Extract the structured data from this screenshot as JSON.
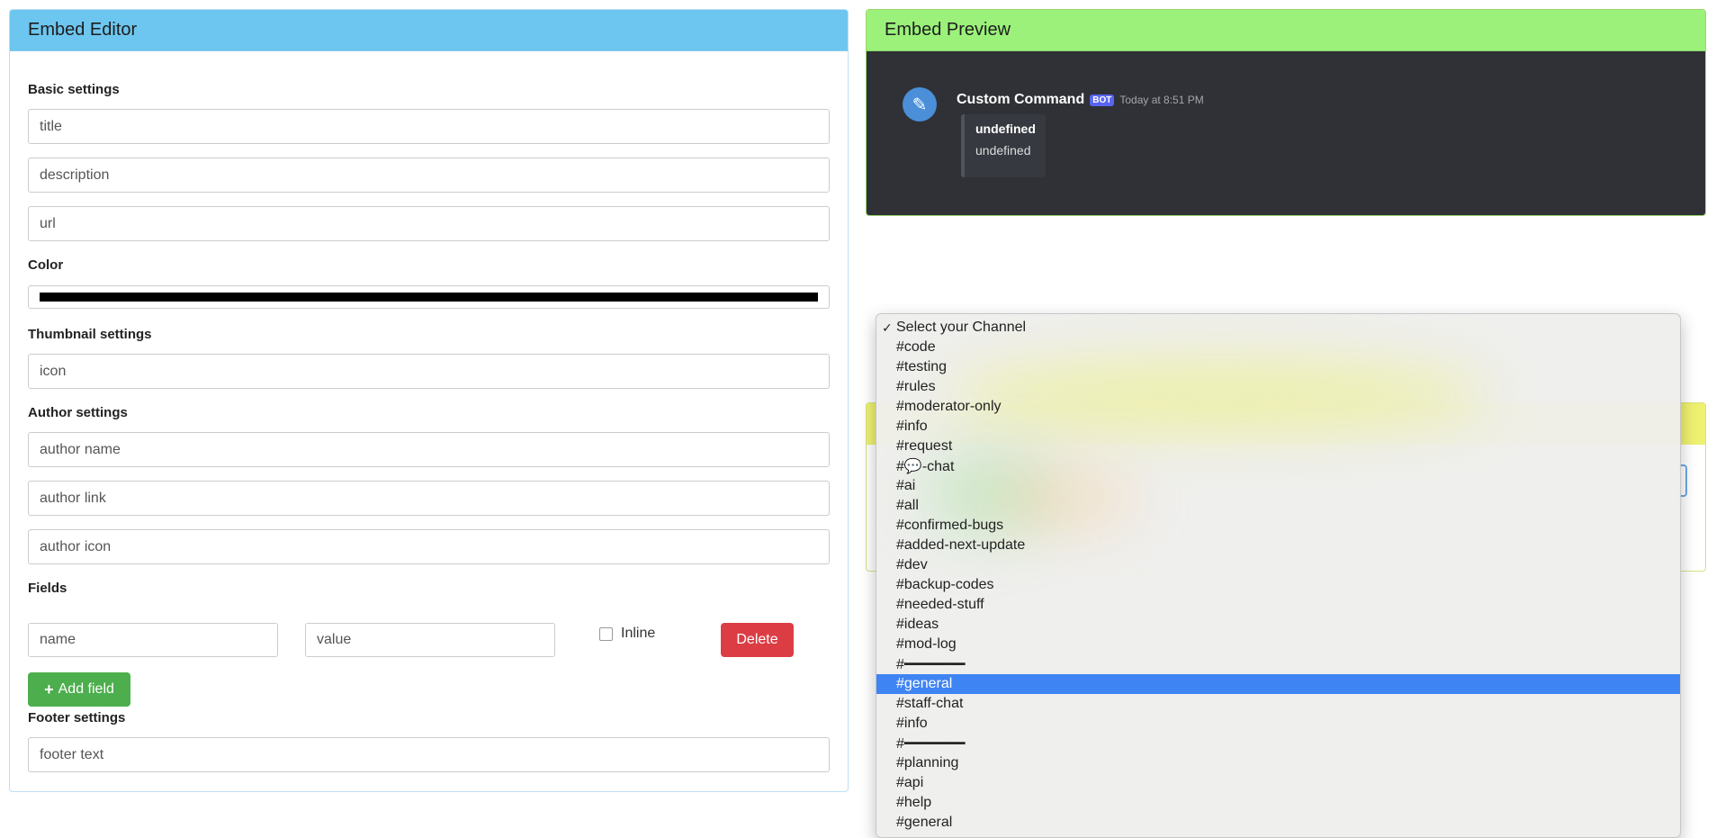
{
  "editor": {
    "title": "Embed Editor",
    "basic_label": "Basic settings",
    "title_placeholder": "title",
    "description_placeholder": "description",
    "url_placeholder": "url",
    "color_label": "Color",
    "color_value": "#000000",
    "thumbnail_label": "Thumbnail settings",
    "icon_placeholder": "icon",
    "author_label": "Author settings",
    "author_name_placeholder": "author name",
    "author_link_placeholder": "author link",
    "author_icon_placeholder": "author icon",
    "fields_label": "Fields",
    "field_name_placeholder": "name",
    "field_value_placeholder": "value",
    "inline_label": "Inline",
    "delete_label": "Delete",
    "add_field_label": "Add field",
    "footer_label": "Footer settings",
    "footer_placeholder": "footer text"
  },
  "preview": {
    "title": "Embed Preview",
    "username": "Custom Command",
    "bot_tag": "BOT",
    "timestamp": "Today at 8:51 PM",
    "embed_title": "undefined",
    "embed_description": "undefined"
  },
  "dropdown": {
    "selected": "Select your Channel",
    "options": [
      "Select your Channel",
      "#code",
      "#testing",
      "#rules",
      "#moderator-only",
      "#info",
      "#request",
      "#💬-chat",
      "#ai",
      "#all",
      "#confirmed-bugs",
      "#added-next-update",
      "#dev",
      "#backup-codes",
      "#needed-stuff",
      "#ideas",
      "#mod-log",
      "#━━━━━━━",
      "#general",
      "#staff-chat",
      "#info",
      "#━━━━━━━",
      "#planning",
      "#api",
      "#help",
      "#general"
    ],
    "highlighted_index": 18
  },
  "colors": {
    "editor_header": "#6dc6ef",
    "preview_header": "#9bf17a",
    "delete_button": "#dc3d45",
    "add_button": "#4cae4c",
    "highlight": "#3f84f3",
    "discord_bg": "#2f3136"
  }
}
